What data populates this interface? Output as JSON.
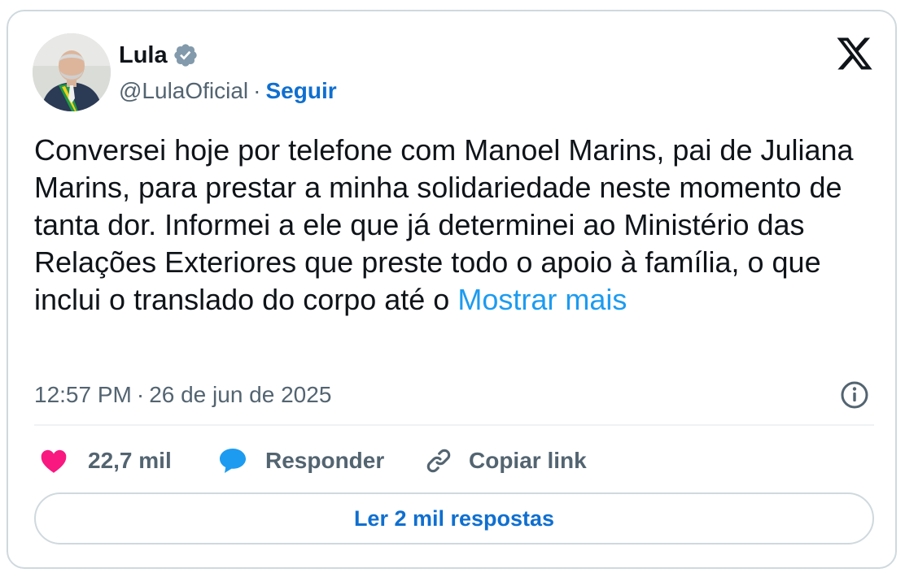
{
  "author": {
    "display_name": "Lula",
    "handle": "@LulaOficial",
    "separator": "·",
    "follow_label": "Seguir",
    "verified": true
  },
  "tweet": {
    "text": "Conversei hoje por telefone com Manoel Marins, pai de Juliana Marins, para prestar a minha solidariedade neste momento de tanta dor. Informei a ele que já determinei ao Ministério das Relações Exteriores que preste todo o apoio à família, o que inclui o translado do corpo até o",
    "show_more_label": "Mostrar mais",
    "time": "12:57 PM",
    "date_separator": "·",
    "date": "26 de jun de 2025"
  },
  "actions": {
    "like_count": "22,7 mil",
    "reply_label": "Responder",
    "copy_link_label": "Copiar link"
  },
  "read_replies_label": "Ler 2 mil respostas",
  "icons": {
    "brand": "x-logo-icon",
    "verified": "verified-badge-icon",
    "info": "info-icon",
    "like": "heart-icon",
    "reply": "speech-bubble-icon",
    "copy_link": "link-icon"
  },
  "colors": {
    "text_primary": "#0f1419",
    "text_secondary": "#536471",
    "link_blue": "#1d9bf0",
    "follow_blue": "#0f6fd0",
    "heart_pink": "#f91880",
    "border": "#cfd9de"
  }
}
